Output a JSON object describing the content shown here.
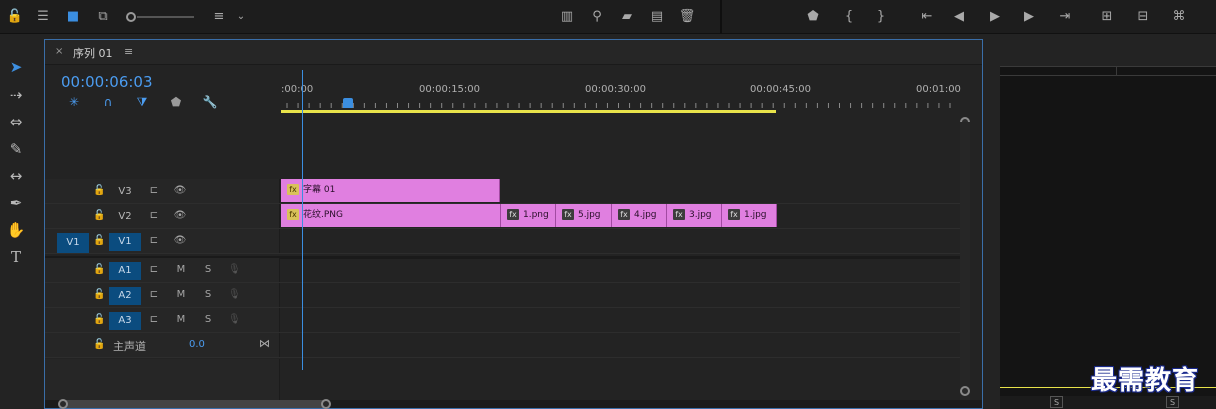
{
  "sequence": {
    "tab_name": "序列 01",
    "timecode": "00:00:06:03"
  },
  "ruler": {
    "labels": [
      ":00:00",
      "00:00:15:00",
      "00:00:30:00",
      "00:00:45:00",
      "00:01:00"
    ]
  },
  "tracks": {
    "v3": {
      "name": "V3"
    },
    "v2": {
      "name": "V2"
    },
    "v1": {
      "name": "V1",
      "source": "V1"
    },
    "a1": {
      "name": "A1",
      "m": "M",
      "s": "S"
    },
    "a2": {
      "name": "A2",
      "m": "M",
      "s": "S"
    },
    "a3": {
      "name": "A3",
      "m": "M",
      "s": "S"
    },
    "master": {
      "name": "主声道",
      "value": "0.0"
    }
  },
  "clips": {
    "v3": [
      {
        "label": "字幕 01",
        "fx": "fx"
      }
    ],
    "v2": [
      {
        "label": "花纹.PNG",
        "fx": "fx"
      },
      {
        "label": "1.png",
        "fx": "fx"
      },
      {
        "label": "5.jpg",
        "fx": "fx"
      },
      {
        "label": "4.jpg",
        "fx": "fx"
      },
      {
        "label": "3.jpg",
        "fx": "fx"
      },
      {
        "label": "1.jpg",
        "fx": "fx"
      }
    ]
  },
  "program": {
    "s_left": "S",
    "s_right": "S"
  },
  "watermark": "最需教育",
  "colors": {
    "accent": "#3b8ee0",
    "clip": "#e07fe0",
    "workarea": "#e8e34a"
  }
}
